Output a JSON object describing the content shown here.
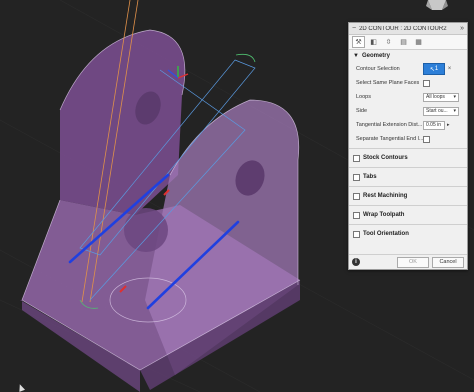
{
  "panel": {
    "title": "2D CONTOUR : 2D CONTOUR2",
    "tabs": [
      "tool-tab",
      "shape-tab",
      "heights-tab",
      "passes-tab",
      "linking-tab"
    ],
    "geometry": {
      "label": "Geometry",
      "contour_selection": {
        "label": "Contour Selection",
        "value": "1",
        "clear": "×"
      },
      "same_plane": {
        "label": "Select Same Plane Faces"
      },
      "loops": {
        "label": "Loops",
        "value": "All loops"
      },
      "side": {
        "label": "Side",
        "value": "Start ou..."
      },
      "tangential_extension": {
        "label": "Tangential Extension Dist...",
        "value": "0.05 in"
      },
      "separate_tangential": {
        "label": "Separate Tangential End l..."
      }
    },
    "sections": [
      {
        "label": "Stock Contours"
      },
      {
        "label": "Tabs"
      },
      {
        "label": "Rest Machining"
      },
      {
        "label": "Wrap Toolpath"
      },
      {
        "label": "Tool Orientation"
      }
    ],
    "footer": {
      "ok": "OK",
      "cancel": "Cancel"
    }
  },
  "colors": {
    "background": "#232323",
    "part_fill": "#8a5aa0",
    "toolpath_blue": "#2040e0",
    "panel_bg": "#f0f0f0",
    "select_blue": "#2d7fd8"
  }
}
